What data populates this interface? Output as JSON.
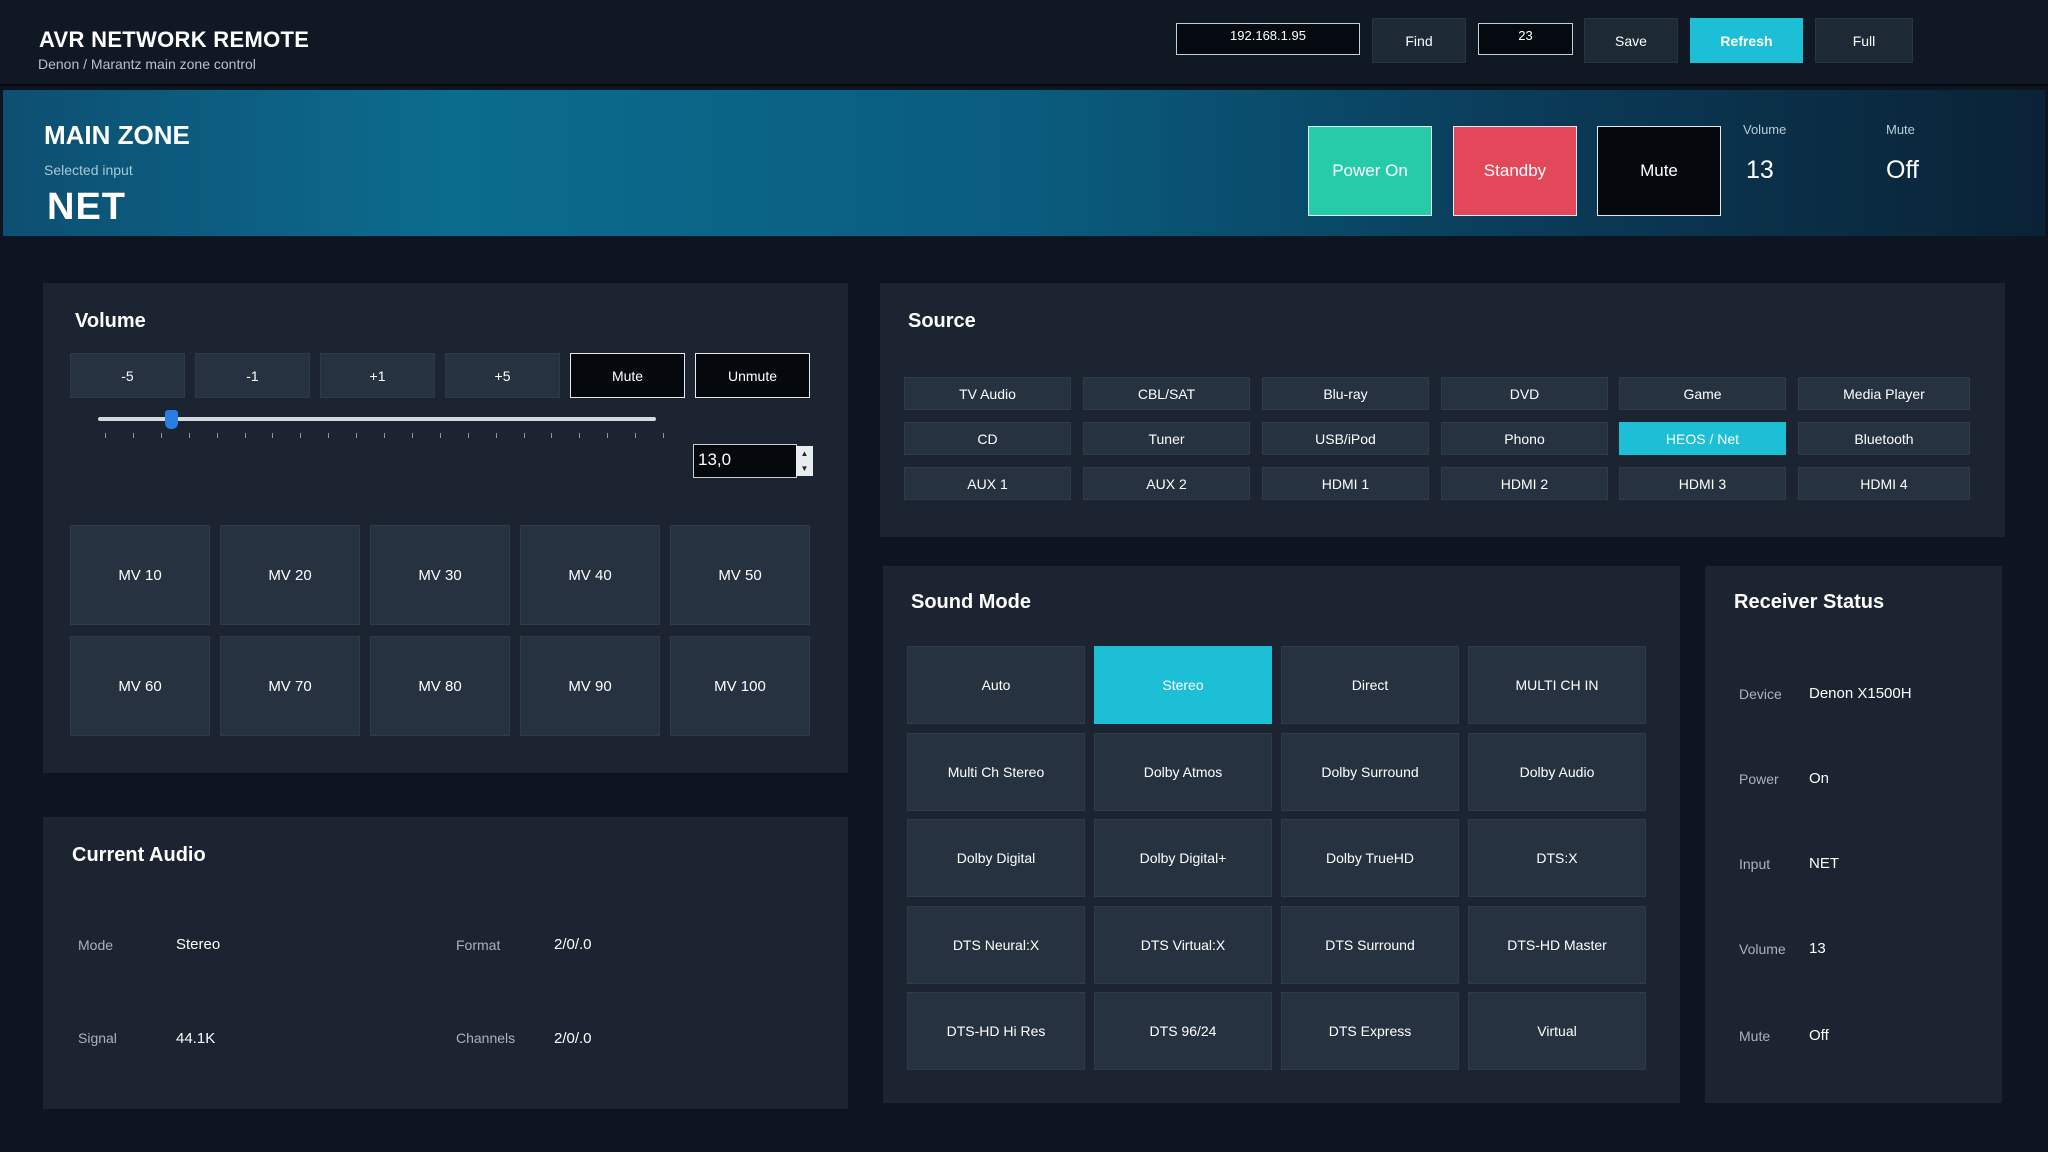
{
  "header": {
    "title": "AVR NETWORK REMOTE",
    "subtitle": "Denon / Marantz main zone control",
    "ip_value": "192.168.1.95",
    "port_value": "23",
    "find_label": "Find",
    "save_label": "Save",
    "refresh_label": "Refresh",
    "full_label": "Full"
  },
  "zone": {
    "title": "MAIN ZONE",
    "selected_input_label": "Selected input",
    "selected_input": "NET",
    "power_on_label": "Power On",
    "standby_label": "Standby",
    "mute_label": "Mute",
    "volume_label": "Volume",
    "volume_value": "13",
    "mute_state_label": "Mute",
    "mute_state_value": "Off"
  },
  "volume": {
    "title": "Volume",
    "steps": [
      "-5",
      "-1",
      "+1",
      "+5"
    ],
    "mute_label": "Mute",
    "unmute_label": "Unmute",
    "value": "13,0",
    "slider_fraction": 0.13,
    "presets": [
      "MV 10",
      "MV 20",
      "MV 30",
      "MV 40",
      "MV 50",
      "MV 60",
      "MV 70",
      "MV 80",
      "MV 90",
      "MV 100"
    ]
  },
  "current_audio": {
    "title": "Current Audio",
    "mode_label": "Mode",
    "mode_value": "Stereo",
    "format_label": "Format",
    "format_value": "2/0/.0",
    "signal_label": "Signal",
    "signal_value": "44.1K",
    "channels_label": "Channels",
    "channels_value": "2/0/.0"
  },
  "source": {
    "title": "Source",
    "items": [
      "TV Audio",
      "CBL/SAT",
      "Blu-ray",
      "DVD",
      "Game",
      "Media Player",
      "CD",
      "Tuner",
      "USB/iPod",
      "Phono",
      "HEOS / Net",
      "Bluetooth",
      "AUX 1",
      "AUX 2",
      "HDMI 1",
      "HDMI 2",
      "HDMI 3",
      "HDMI 4"
    ],
    "selected": "HEOS / Net"
  },
  "sound_mode": {
    "title": "Sound Mode",
    "items": [
      "Auto",
      "Stereo",
      "Direct",
      "MULTI CH IN",
      "Multi Ch Stereo",
      "Dolby Atmos",
      "Dolby Surround",
      "Dolby Audio",
      "Dolby Digital",
      "Dolby Digital+",
      "Dolby TrueHD",
      "DTS:X",
      "DTS Neural:X",
      "DTS Virtual:X",
      "DTS Surround",
      "DTS-HD Master",
      "DTS-HD Hi Res",
      "DTS 96/24",
      "DTS Express",
      "Virtual"
    ],
    "selected": "Stereo"
  },
  "receiver_status": {
    "title": "Receiver Status",
    "rows": [
      {
        "label": "Device",
        "value": "Denon X1500H"
      },
      {
        "label": "Power",
        "value": "On"
      },
      {
        "label": "Input",
        "value": "NET"
      },
      {
        "label": "Volume",
        "value": "13"
      },
      {
        "label": "Mute",
        "value": "Off"
      }
    ]
  },
  "colors": {
    "accent": "#1cbfd6",
    "power_on": "#26cca9",
    "standby": "#e2475a",
    "panel": "#1b2430",
    "background": "#0d1520"
  }
}
